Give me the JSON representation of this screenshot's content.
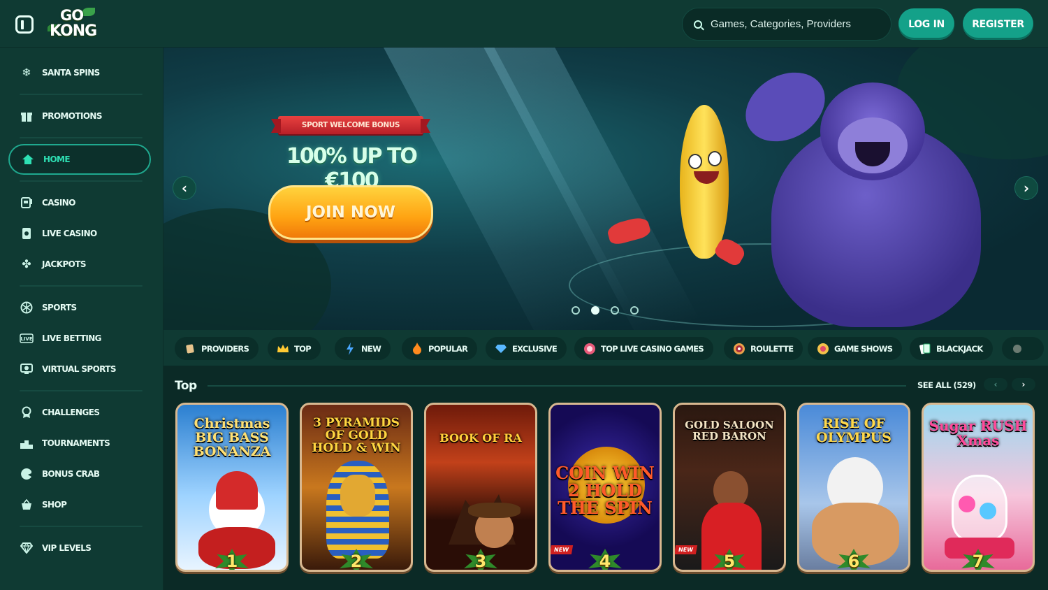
{
  "header": {
    "logo_text_top": "GO",
    "logo_text_bottom": "KONG",
    "search_placeholder": "Games, Categories, Providers",
    "login_label": "LOG IN",
    "register_label": "REGISTER"
  },
  "sidebar": {
    "items": [
      {
        "label": "SANTA SPINS",
        "icon": "snowflake-icon"
      },
      {
        "label": "PROMOTIONS",
        "icon": "gift-icon"
      },
      {
        "label": "HOME",
        "icon": "home-icon",
        "active": true
      },
      {
        "label": "CASINO",
        "icon": "slot-machine-icon"
      },
      {
        "label": "LIVE CASINO",
        "icon": "live-card-icon"
      },
      {
        "label": "JACKPOTS",
        "icon": "clover-icon"
      },
      {
        "label": "SPORTS",
        "icon": "basketball-icon"
      },
      {
        "label": "LIVE BETTING",
        "icon": "live-badge-icon"
      },
      {
        "label": "VIRTUAL SPORTS",
        "icon": "virtual-sports-icon"
      },
      {
        "label": "CHALLENGES",
        "icon": "medal-icon"
      },
      {
        "label": "TOURNAMENTS",
        "icon": "podium-icon"
      },
      {
        "label": "BONUS CRAB",
        "icon": "crab-claw-icon"
      },
      {
        "label": "SHOP",
        "icon": "basket-icon"
      },
      {
        "label": "VIP LEVELS",
        "icon": "diamond-icon"
      }
    ]
  },
  "hero": {
    "ribbon": "SPORT WELCOME BONUS",
    "headline": "100% UP TO €100",
    "cta": "JOIN NOW",
    "slides": 4,
    "active_slide": 2
  },
  "categories": [
    {
      "label": "PROVIDERS",
      "icon": "scroll-icon"
    },
    {
      "label": "TOP",
      "icon": "crown-icon"
    },
    {
      "label": "NEW",
      "icon": "lightning-icon"
    },
    {
      "label": "POPULAR",
      "icon": "flame-icon"
    },
    {
      "label": "EXCLUSIVE",
      "icon": "gem-icon"
    },
    {
      "label": "TOP LIVE CASINO GAMES",
      "icon": "chip-icon"
    },
    {
      "label": "ROULETTE",
      "icon": "roulette-icon"
    },
    {
      "label": "GAME SHOWS",
      "icon": "wheel-icon"
    },
    {
      "label": "BLACKJACK",
      "icon": "cards-icon"
    }
  ],
  "top_section": {
    "title": "Top",
    "see_all": "SEE ALL (529)",
    "prev": "‹",
    "next": "›",
    "games": [
      {
        "title": "Christmas BIG BASS BONANZA",
        "rank": "1",
        "new": false
      },
      {
        "title": "3 PYRAMIDS OF GOLD HOLD & WIN",
        "rank": "2",
        "new": false
      },
      {
        "title": "BOOK OF RA",
        "rank": "3",
        "new": false
      },
      {
        "title": "COIN WIN 2 HOLD THE SPIN",
        "rank": "4",
        "new": true
      },
      {
        "title": "GOLD SALOON RED BARON",
        "rank": "5",
        "new": true
      },
      {
        "title": "RISE OF OLYMPUS",
        "rank": "6",
        "new": false
      },
      {
        "title": "Sugar RUSH Xmas",
        "rank": "7",
        "new": false
      }
    ],
    "new_tag": "NEW"
  }
}
